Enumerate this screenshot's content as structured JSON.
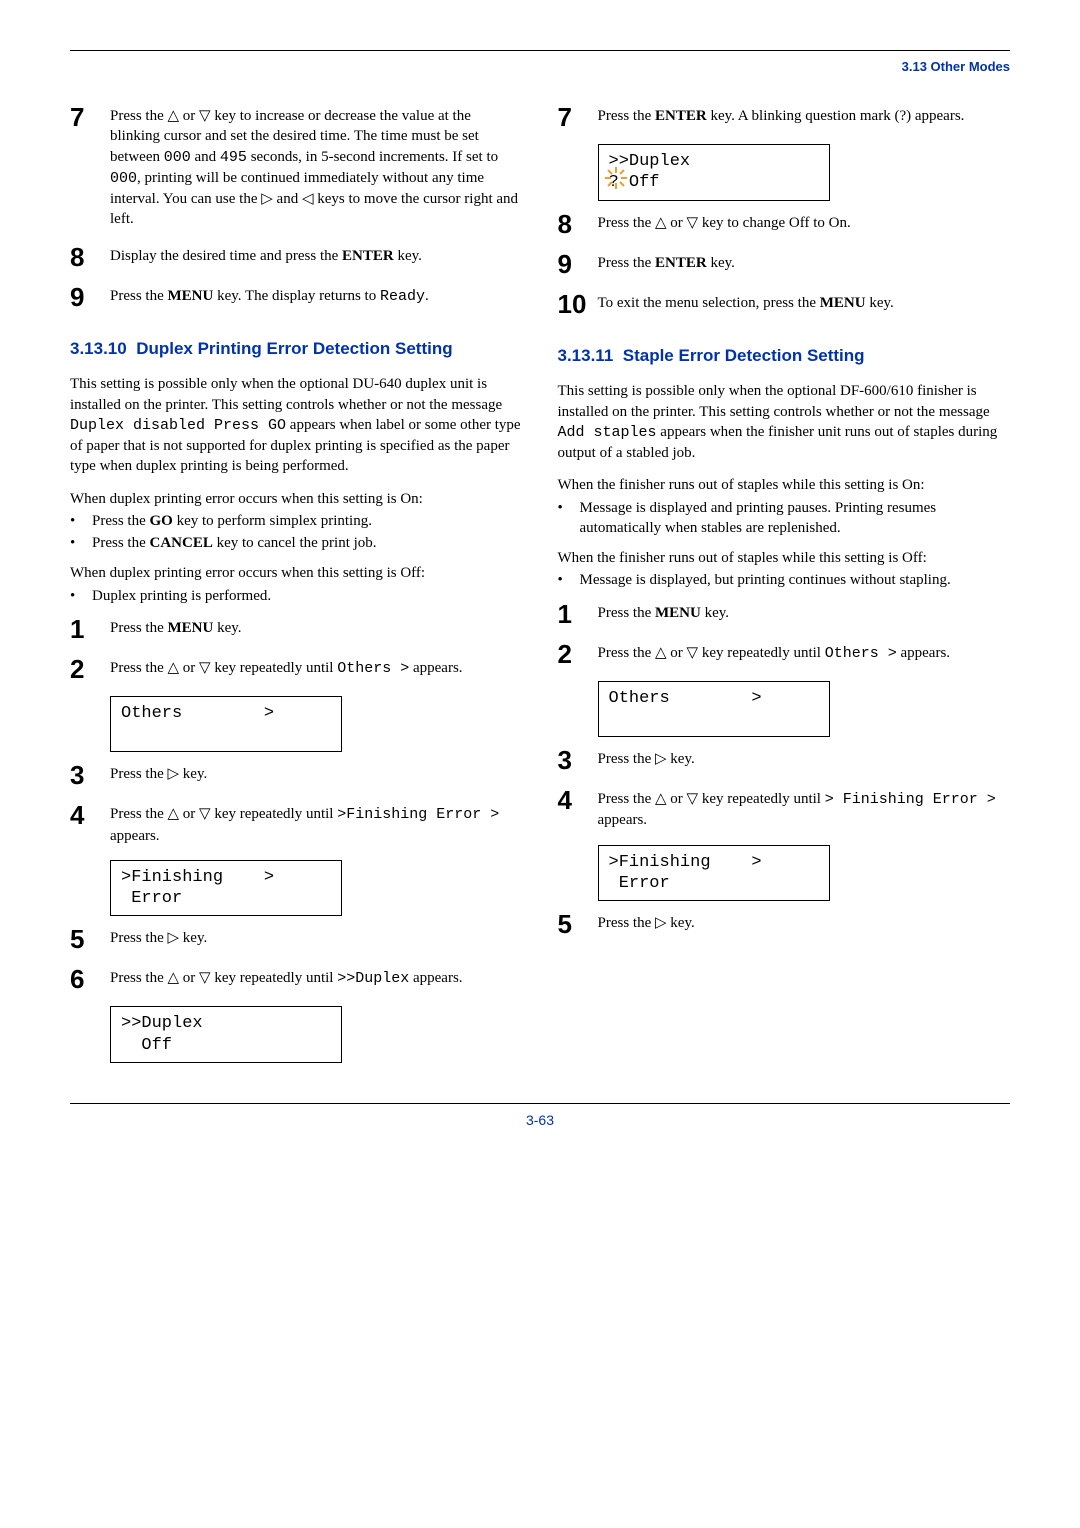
{
  "header": {
    "breadcrumb": "3.13 Other Modes"
  },
  "symbols": {
    "up": "△",
    "down": "▽",
    "right": "▷",
    "left": "◁"
  },
  "left": {
    "step7": "Press the △ or ▽ key to increase or decrease the value at the blinking cursor and set the desired time. The time must be set between 000 and 495 seconds, in 5-second increments. If set to 000, printing will be continued immediately without any time interval. You can use the ▷ and ◁ keys to move the cursor right and left.",
    "step8": "Display the desired time and press the ENTER key.",
    "step9": "Press the MENU key. The display returns to Ready.",
    "section_num": "3.13.10",
    "section_title": "Duplex Printing Error Detection Setting",
    "intro": "This setting is possible only when the optional DU-640 duplex unit is installed on the printer. This setting controls whether or not the message Duplex disabled Press GO appears when label or some other type of paper that is not supported for duplex printing is specified as the paper type when duplex printing is being performed.",
    "on_line": "When duplex printing error occurs when this setting is On:",
    "on_b1": "Press the GO key to perform simplex printing.",
    "on_b2": "Press the CANCEL key to cancel the print job.",
    "off_line": "When duplex printing error occurs when this setting is Off:",
    "off_b1": "Duplex printing is performed.",
    "s1": "Press the MENU key.",
    "s2": "Press the △ or ▽ key repeatedly until Others > appears.",
    "disp2": "Others        >",
    "s3": "Press the ▷ key.",
    "s4": "Press the △ or ▽ key repeatedly until >Finishing Error > appears.",
    "disp4a": ">Finishing    >",
    "disp4b": " Error",
    "s5": "Press the ▷ key.",
    "s6": "Press the △ or ▽ key repeatedly until >>Duplex appears.",
    "disp6a": ">>Duplex",
    "disp6b": "  Off"
  },
  "right": {
    "s7": "Press the ENTER key. A blinking question mark (?) appears.",
    "disp7a": ">>Duplex",
    "disp7b": "? Off",
    "s8": "Press the △ or ▽ key to change Off to On.",
    "s9": "Press the ENTER key.",
    "s10": "To exit the menu selection, press the MENU key.",
    "section_num": "3.13.11",
    "section_title": "Staple Error Detection Setting",
    "intro": "This setting is possible only when the optional DF-600/610 finisher is installed on the printer. This setting controls whether or not the message Add staples appears when the finisher unit runs out of staples during output of a stabled job.",
    "on_line": "When the finisher runs out of staples while this setting is On:",
    "on_b1": "Message is displayed and printing pauses. Printing resumes automatically when stables are replenished.",
    "off_line": "When the finisher runs out of staples while this setting is Off:",
    "off_b1": "Message is displayed, but printing continues without stapling.",
    "r1": "Press the MENU key.",
    "r2": "Press the △ or ▽ key repeatedly until Others > appears.",
    "disp2": "Others        >",
    "r3": "Press the ▷ key.",
    "r4": "Press the △ or ▽ key repeatedly until > Finishing Error > appears.",
    "disp4a": ">Finishing    >",
    "disp4b": " Error",
    "r5": "Press the ▷ key."
  },
  "footer": {
    "page": "3-63"
  }
}
